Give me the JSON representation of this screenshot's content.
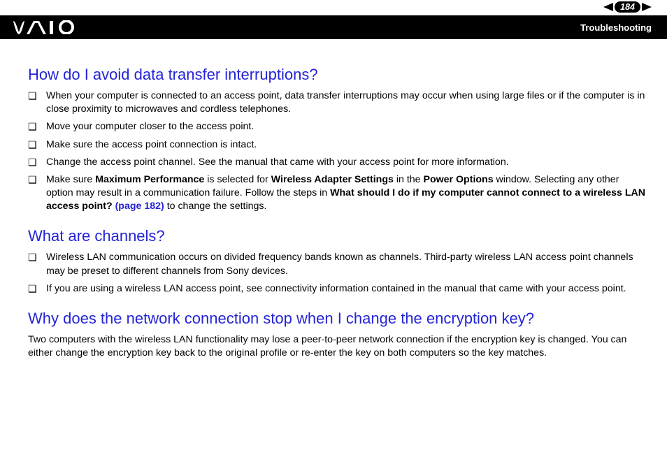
{
  "header": {
    "page_number": "184",
    "section": "Troubleshooting"
  },
  "sections": [
    {
      "heading": "How do I avoid data transfer interruptions?",
      "bullets": [
        [
          {
            "t": "When your computer is connected to an access point, data transfer interruptions may occur when using large files or if the computer is in close proximity to microwaves and cordless telephones."
          }
        ],
        [
          {
            "t": "Move your computer closer to the access point."
          }
        ],
        [
          {
            "t": "Make sure the access point connection is intact."
          }
        ],
        [
          {
            "t": "Change the access point channel. See the manual that came with your access point for more information."
          }
        ],
        [
          {
            "t": "Make sure "
          },
          {
            "t": "Maximum Performance",
            "b": true
          },
          {
            "t": " is selected for "
          },
          {
            "t": "Wireless Adapter Settings",
            "b": true
          },
          {
            "t": " in the "
          },
          {
            "t": "Power Options",
            "b": true
          },
          {
            "t": " window. Selecting any other option may result in a communication failure. Follow the steps in "
          },
          {
            "t": "What should I do if my computer cannot connect to a wireless LAN access point? ",
            "b": true
          },
          {
            "t": "(page 182)",
            "link": true
          },
          {
            "t": " to change the settings."
          }
        ]
      ]
    },
    {
      "heading": "What are channels?",
      "bullets": [
        [
          {
            "t": "Wireless LAN communication occurs on divided frequency bands known as channels. Third-party wireless LAN access point channels may be preset to different channels from Sony devices."
          }
        ],
        [
          {
            "t": "If you are using a wireless LAN access point, see connectivity information contained in the manual that came with your access point."
          }
        ]
      ]
    },
    {
      "heading": "Why does the network connection stop when I change the encryption key?",
      "body": "Two computers with the wireless LAN functionality may lose a peer-to-peer network connection if the encryption key is changed. You can either change the encryption key back to the original profile or re-enter the key on both computers so the key matches."
    }
  ]
}
